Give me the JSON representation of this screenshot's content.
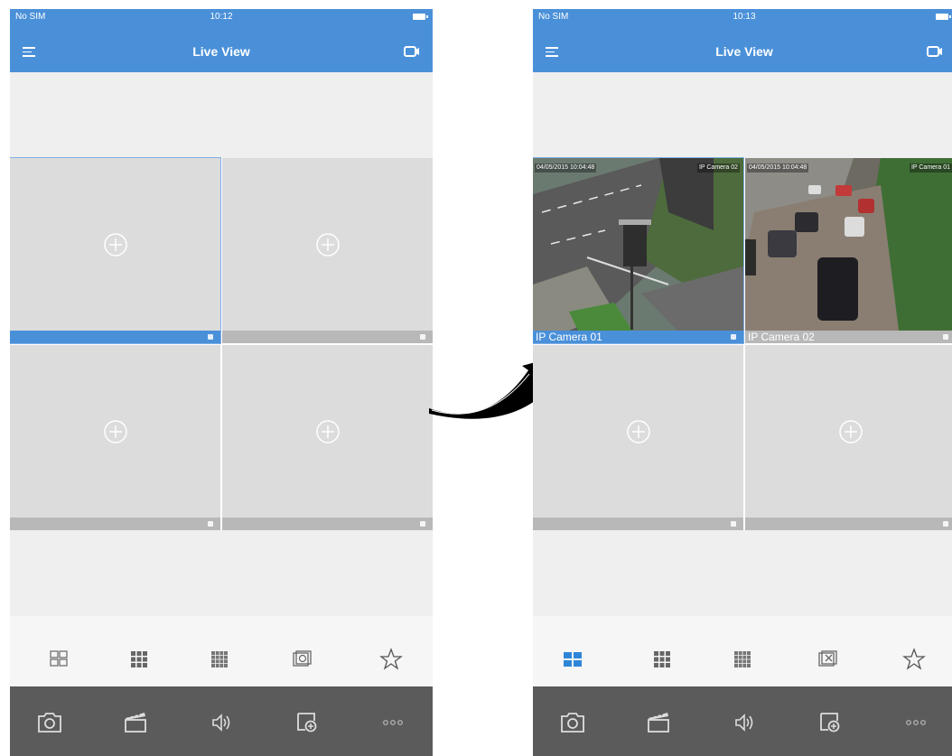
{
  "left_screen": {
    "status": {
      "carrier": "No SIM",
      "time": "10:12"
    },
    "header": {
      "title": "Live View"
    },
    "tiles": [
      {
        "label": ""
      },
      {
        "label": ""
      },
      {
        "label": ""
      },
      {
        "label": ""
      }
    ],
    "layouts": [
      "2x2-grid-icon",
      "3x3-grid-icon",
      "4x4-grid-icon",
      "screen-switch-icon",
      "star-icon"
    ],
    "toolbar": [
      "camera-snapshot-icon",
      "clapper-record-icon",
      "speaker-icon",
      "window-add-icon",
      "more-icon"
    ]
  },
  "right_screen": {
    "status": {
      "carrier": "No SIM",
      "time": "10:13"
    },
    "header": {
      "title": "Live View"
    },
    "tiles": [
      {
        "label": "IP Camera 01",
        "osd_date": "04/05/2015 10:04:48",
        "osd_name": "IP Camera 02"
      },
      {
        "label": "IP Camera 02",
        "osd_date": "04/05/2015 10:04:48",
        "osd_name": "IP Camera 01"
      },
      {
        "label": ""
      },
      {
        "label": ""
      }
    ],
    "layouts": [
      "2x2-grid-icon-active",
      "3x3-grid-icon",
      "4x4-grid-icon",
      "close-window-icon",
      "star-icon"
    ],
    "toolbar": [
      "camera-snapshot-icon",
      "clapper-record-icon",
      "speaker-icon",
      "window-add-icon",
      "more-icon"
    ]
  },
  "colors": {
    "accent": "#4a90d9",
    "tile_bg": "#dcdcdc",
    "toolbar_bg": "#5b5b5b"
  }
}
